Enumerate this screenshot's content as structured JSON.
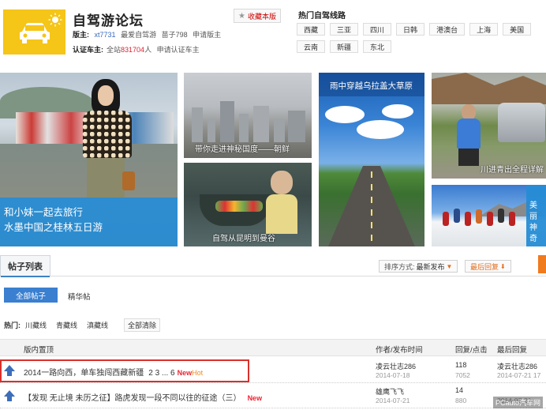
{
  "header": {
    "forum_title": "自驾游论坛",
    "fav_label": "收藏本版",
    "mod_label": "版主:",
    "mod_names": [
      "xt7731",
      "最爱自驾游",
      "苗子798"
    ],
    "apply_mod": "申请版主",
    "cert_label": "认证车主:",
    "cert_text_prefix": "全站",
    "cert_count": "831704",
    "cert_text_suffix": "人",
    "apply_cert": "申请认证车主",
    "route_title": "热门自驾线路",
    "routes": [
      "西藏",
      "三亚",
      "四川",
      "日韩",
      "港澳台",
      "上海",
      "美国",
      "云南",
      "新疆",
      "东北"
    ]
  },
  "mosaic": {
    "t1_line1": "和小妹一起去旅行",
    "t1_line2": "水墨中国之桂林五日游",
    "t2_caption": "带你走进神秘国度——朝鲜",
    "t3_caption": "自驾从昆明到曼谷",
    "t4_caption": "雨中穿越乌拉盖大草原",
    "t5_caption": "川进青出全程详解",
    "t7_caption": "美丽 神奇"
  },
  "list": {
    "tab_label": "帖子列表",
    "sort_label": "排序方式:",
    "sort_value": "最新发布",
    "latest_reply": "最后回复",
    "filter_all": "全部帖子",
    "filter_best": "精华帖",
    "hot_label": "热门:",
    "hot_tags": [
      "川藏线",
      "青藏线",
      "滇藏线"
    ],
    "clear_label": "全部清除",
    "col_topic": "版内置顶",
    "col_author": "作者/发布时间",
    "col_stats": "回复/点击",
    "col_last": "最后回复"
  },
  "posts": [
    {
      "title": "2014一路向西，单车独闯西藏新疆",
      "pages": "2 3 ... 6",
      "badge_new": "New",
      "badge_hot": "Hot",
      "author": "凌云壮志286",
      "date": "2014-07-18",
      "replies": "118",
      "clicks": "7052",
      "last_user": "凌云壮志286",
      "last_date": "2014-07-21 17"
    },
    {
      "title": "【发现 无止境 未历之征】路虎发现一段不同以往的征途（三）",
      "pages": "",
      "badge_new": "New",
      "badge_hot": "",
      "author": "雄鹰飞飞",
      "date": "2014-07-21",
      "replies": "14",
      "clicks": "880",
      "last_user": "",
      "last_date": "2014-07-21"
    }
  ],
  "watermark": "PCauto汽车网"
}
